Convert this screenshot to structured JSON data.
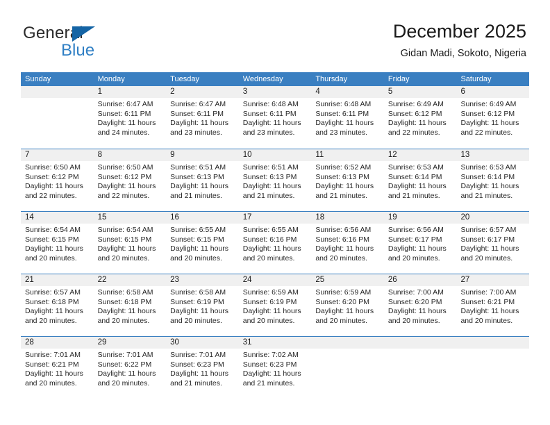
{
  "brand": {
    "word_one": "General",
    "word_two": "Blue",
    "triangle_icon": "blue-triangle-logo",
    "accent_dark": "#1464a5",
    "accent_light": "#2f7fc4"
  },
  "header": {
    "title": "December 2025",
    "subtitle": "Gidan Madi, Sokoto, Nigeria"
  },
  "theme": {
    "header_blue": "#3a7fc1",
    "daynum_band": "#f0f0f0",
    "text": "#262626"
  },
  "weekdays": [
    "Sunday",
    "Monday",
    "Tuesday",
    "Wednesday",
    "Thursday",
    "Friday",
    "Saturday"
  ],
  "weeks": [
    [
      {
        "day": "",
        "sunrise": "",
        "sunset": "",
        "daylight_line1": "",
        "daylight_line2": "",
        "empty": true
      },
      {
        "day": "1",
        "sunrise": "Sunrise: 6:47 AM",
        "sunset": "Sunset: 6:11 PM",
        "daylight_line1": "Daylight: 11 hours",
        "daylight_line2": "and 24 minutes.",
        "empty": false
      },
      {
        "day": "2",
        "sunrise": "Sunrise: 6:47 AM",
        "sunset": "Sunset: 6:11 PM",
        "daylight_line1": "Daylight: 11 hours",
        "daylight_line2": "and 23 minutes.",
        "empty": false
      },
      {
        "day": "3",
        "sunrise": "Sunrise: 6:48 AM",
        "sunset": "Sunset: 6:11 PM",
        "daylight_line1": "Daylight: 11 hours",
        "daylight_line2": "and 23 minutes.",
        "empty": false
      },
      {
        "day": "4",
        "sunrise": "Sunrise: 6:48 AM",
        "sunset": "Sunset: 6:11 PM",
        "daylight_line1": "Daylight: 11 hours",
        "daylight_line2": "and 23 minutes.",
        "empty": false
      },
      {
        "day": "5",
        "sunrise": "Sunrise: 6:49 AM",
        "sunset": "Sunset: 6:12 PM",
        "daylight_line1": "Daylight: 11 hours",
        "daylight_line2": "and 22 minutes.",
        "empty": false
      },
      {
        "day": "6",
        "sunrise": "Sunrise: 6:49 AM",
        "sunset": "Sunset: 6:12 PM",
        "daylight_line1": "Daylight: 11 hours",
        "daylight_line2": "and 22 minutes.",
        "empty": false
      }
    ],
    [
      {
        "day": "7",
        "sunrise": "Sunrise: 6:50 AM",
        "sunset": "Sunset: 6:12 PM",
        "daylight_line1": "Daylight: 11 hours",
        "daylight_line2": "and 22 minutes.",
        "empty": false
      },
      {
        "day": "8",
        "sunrise": "Sunrise: 6:50 AM",
        "sunset": "Sunset: 6:12 PM",
        "daylight_line1": "Daylight: 11 hours",
        "daylight_line2": "and 22 minutes.",
        "empty": false
      },
      {
        "day": "9",
        "sunrise": "Sunrise: 6:51 AM",
        "sunset": "Sunset: 6:13 PM",
        "daylight_line1": "Daylight: 11 hours",
        "daylight_line2": "and 21 minutes.",
        "empty": false
      },
      {
        "day": "10",
        "sunrise": "Sunrise: 6:51 AM",
        "sunset": "Sunset: 6:13 PM",
        "daylight_line1": "Daylight: 11 hours",
        "daylight_line2": "and 21 minutes.",
        "empty": false
      },
      {
        "day": "11",
        "sunrise": "Sunrise: 6:52 AM",
        "sunset": "Sunset: 6:13 PM",
        "daylight_line1": "Daylight: 11 hours",
        "daylight_line2": "and 21 minutes.",
        "empty": false
      },
      {
        "day": "12",
        "sunrise": "Sunrise: 6:53 AM",
        "sunset": "Sunset: 6:14 PM",
        "daylight_line1": "Daylight: 11 hours",
        "daylight_line2": "and 21 minutes.",
        "empty": false
      },
      {
        "day": "13",
        "sunrise": "Sunrise: 6:53 AM",
        "sunset": "Sunset: 6:14 PM",
        "daylight_line1": "Daylight: 11 hours",
        "daylight_line2": "and 21 minutes.",
        "empty": false
      }
    ],
    [
      {
        "day": "14",
        "sunrise": "Sunrise: 6:54 AM",
        "sunset": "Sunset: 6:15 PM",
        "daylight_line1": "Daylight: 11 hours",
        "daylight_line2": "and 20 minutes.",
        "empty": false
      },
      {
        "day": "15",
        "sunrise": "Sunrise: 6:54 AM",
        "sunset": "Sunset: 6:15 PM",
        "daylight_line1": "Daylight: 11 hours",
        "daylight_line2": "and 20 minutes.",
        "empty": false
      },
      {
        "day": "16",
        "sunrise": "Sunrise: 6:55 AM",
        "sunset": "Sunset: 6:15 PM",
        "daylight_line1": "Daylight: 11 hours",
        "daylight_line2": "and 20 minutes.",
        "empty": false
      },
      {
        "day": "17",
        "sunrise": "Sunrise: 6:55 AM",
        "sunset": "Sunset: 6:16 PM",
        "daylight_line1": "Daylight: 11 hours",
        "daylight_line2": "and 20 minutes.",
        "empty": false
      },
      {
        "day": "18",
        "sunrise": "Sunrise: 6:56 AM",
        "sunset": "Sunset: 6:16 PM",
        "daylight_line1": "Daylight: 11 hours",
        "daylight_line2": "and 20 minutes.",
        "empty": false
      },
      {
        "day": "19",
        "sunrise": "Sunrise: 6:56 AM",
        "sunset": "Sunset: 6:17 PM",
        "daylight_line1": "Daylight: 11 hours",
        "daylight_line2": "and 20 minutes.",
        "empty": false
      },
      {
        "day": "20",
        "sunrise": "Sunrise: 6:57 AM",
        "sunset": "Sunset: 6:17 PM",
        "daylight_line1": "Daylight: 11 hours",
        "daylight_line2": "and 20 minutes.",
        "empty": false
      }
    ],
    [
      {
        "day": "21",
        "sunrise": "Sunrise: 6:57 AM",
        "sunset": "Sunset: 6:18 PM",
        "daylight_line1": "Daylight: 11 hours",
        "daylight_line2": "and 20 minutes.",
        "empty": false
      },
      {
        "day": "22",
        "sunrise": "Sunrise: 6:58 AM",
        "sunset": "Sunset: 6:18 PM",
        "daylight_line1": "Daylight: 11 hours",
        "daylight_line2": "and 20 minutes.",
        "empty": false
      },
      {
        "day": "23",
        "sunrise": "Sunrise: 6:58 AM",
        "sunset": "Sunset: 6:19 PM",
        "daylight_line1": "Daylight: 11 hours",
        "daylight_line2": "and 20 minutes.",
        "empty": false
      },
      {
        "day": "24",
        "sunrise": "Sunrise: 6:59 AM",
        "sunset": "Sunset: 6:19 PM",
        "daylight_line1": "Daylight: 11 hours",
        "daylight_line2": "and 20 minutes.",
        "empty": false
      },
      {
        "day": "25",
        "sunrise": "Sunrise: 6:59 AM",
        "sunset": "Sunset: 6:20 PM",
        "daylight_line1": "Daylight: 11 hours",
        "daylight_line2": "and 20 minutes.",
        "empty": false
      },
      {
        "day": "26",
        "sunrise": "Sunrise: 7:00 AM",
        "sunset": "Sunset: 6:20 PM",
        "daylight_line1": "Daylight: 11 hours",
        "daylight_line2": "and 20 minutes.",
        "empty": false
      },
      {
        "day": "27",
        "sunrise": "Sunrise: 7:00 AM",
        "sunset": "Sunset: 6:21 PM",
        "daylight_line1": "Daylight: 11 hours",
        "daylight_line2": "and 20 minutes.",
        "empty": false
      }
    ],
    [
      {
        "day": "28",
        "sunrise": "Sunrise: 7:01 AM",
        "sunset": "Sunset: 6:21 PM",
        "daylight_line1": "Daylight: 11 hours",
        "daylight_line2": "and 20 minutes.",
        "empty": false
      },
      {
        "day": "29",
        "sunrise": "Sunrise: 7:01 AM",
        "sunset": "Sunset: 6:22 PM",
        "daylight_line1": "Daylight: 11 hours",
        "daylight_line2": "and 20 minutes.",
        "empty": false
      },
      {
        "day": "30",
        "sunrise": "Sunrise: 7:01 AM",
        "sunset": "Sunset: 6:23 PM",
        "daylight_line1": "Daylight: 11 hours",
        "daylight_line2": "and 21 minutes.",
        "empty": false
      },
      {
        "day": "31",
        "sunrise": "Sunrise: 7:02 AM",
        "sunset": "Sunset: 6:23 PM",
        "daylight_line1": "Daylight: 11 hours",
        "daylight_line2": "and 21 minutes.",
        "empty": false
      },
      {
        "day": "",
        "sunrise": "",
        "sunset": "",
        "daylight_line1": "",
        "daylight_line2": "",
        "empty": true
      },
      {
        "day": "",
        "sunrise": "",
        "sunset": "",
        "daylight_line1": "",
        "daylight_line2": "",
        "empty": true
      },
      {
        "day": "",
        "sunrise": "",
        "sunset": "",
        "daylight_line1": "",
        "daylight_line2": "",
        "empty": true
      }
    ]
  ]
}
